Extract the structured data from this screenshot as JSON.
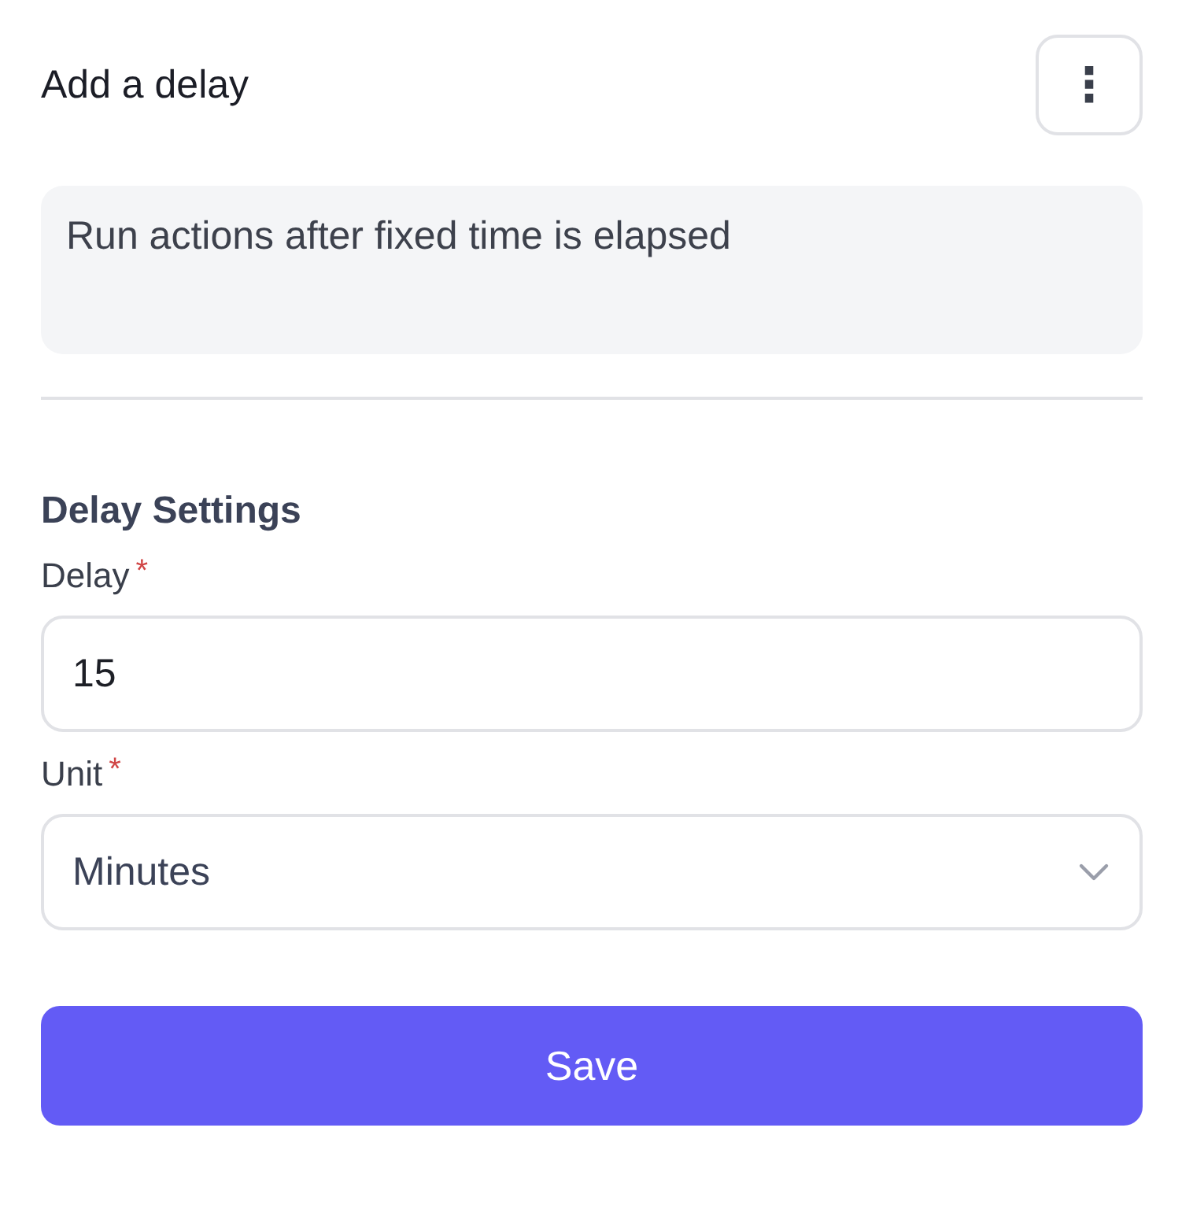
{
  "header": {
    "title": "Add a delay",
    "menu_icon": "⋮"
  },
  "description": "Run actions after fixed time is elapsed",
  "section_title": "Delay Settings",
  "fields": [
    {
      "kind": "input",
      "label": "Delay",
      "required_mark": "*",
      "value": "15"
    },
    {
      "kind": "select",
      "label": "Unit",
      "required_mark": "*",
      "value": "Minutes"
    }
  ],
  "save_button": "Save"
}
